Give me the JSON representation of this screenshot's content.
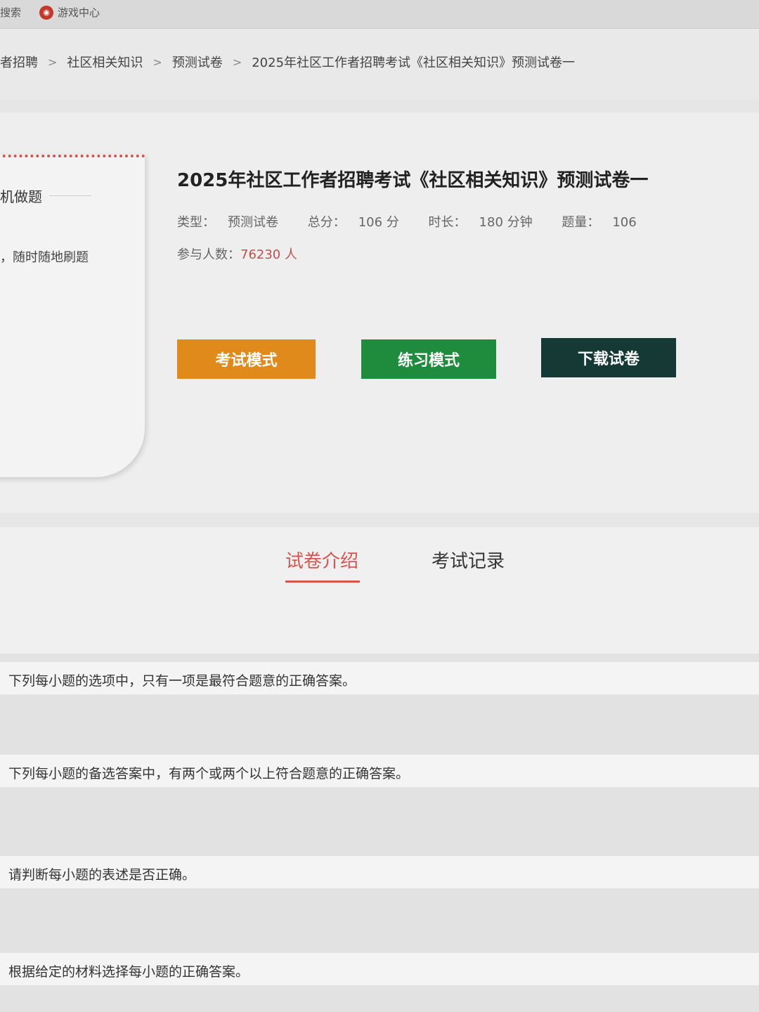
{
  "topbar": {
    "search_label": "搜索",
    "game_center_label": "游戏中心"
  },
  "breadcrumb": {
    "items": [
      "者招聘",
      "社区相关知识",
      "预测试卷",
      "2025年社区工作者招聘考试《社区相关知识》预测试卷一"
    ],
    "separator": ">"
  },
  "side_card": {
    "line1": "机做题",
    "line2": "，随时随地刷题"
  },
  "exam": {
    "title": "2025年社区工作者招聘考试《社区相关知识》预测试卷一",
    "type_label": "类型：",
    "type_value": "预测试卷",
    "score_label": "总分：",
    "score_value": "106 分",
    "duration_label": "时长：",
    "duration_value": "180 分钟",
    "count_label": "题量：",
    "count_value": "106",
    "participants_label": "参与人数：",
    "participants_value": "76230 人"
  },
  "buttons": {
    "exam_mode": "考试模式",
    "practice_mode": "练习模式",
    "download": "下载试卷"
  },
  "tabs": {
    "intro": "试卷介绍",
    "record": "考试记录"
  },
  "sections": [
    "下列每小题的选项中，只有一项是最符合题意的正确答案。",
    "下列每小题的备选答案中，有两个或两个以上符合题意的正确答案。",
    "请判断每小题的表述是否正确。",
    "根据给定的材料选择每小题的正确答案。"
  ],
  "colors": {
    "accent_red": "#d9534f",
    "exam_button": "#e08a1b",
    "practice_button": "#1f8b3c",
    "download_button": "#153a35"
  }
}
